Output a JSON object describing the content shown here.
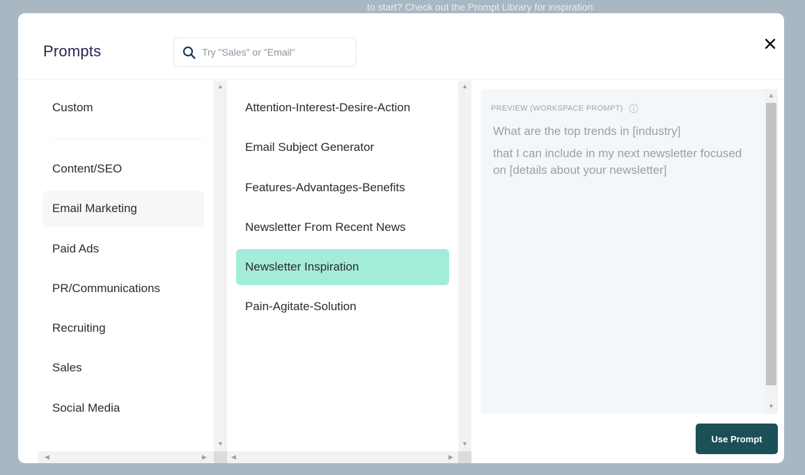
{
  "backdrop": {
    "text": "to start? Check out the Prompt Library for inspiration."
  },
  "header": {
    "title": "Prompts",
    "search_placeholder": "Try \"Sales\" or \"Email\"",
    "search_value": ""
  },
  "categories": [
    "Custom",
    "Content/SEO",
    "Email Marketing",
    "Paid Ads",
    "PR/Communications",
    "Recruiting",
    "Sales",
    "Social Media"
  ],
  "active_category": "Email Marketing",
  "prompts": [
    "Attention-Interest-Desire-Action",
    "Email Subject Generator",
    "Features-Advantages-Benefits",
    "Newsletter From Recent News",
    "Newsletter Inspiration",
    "Pain-Agitate-Solution"
  ],
  "active_prompt": "Newsletter Inspiration",
  "preview": {
    "label": "PREVIEW (WORKSPACE PROMPT)",
    "line1": "What are the top trends in [industry]",
    "line2": "that I can include in my next newsletter focused on [details about your newsletter]"
  },
  "actions": {
    "use_prompt": "Use Prompt"
  },
  "colors": {
    "accent": "#a3ecd9",
    "primary_button": "#1b5058",
    "title": "#2a2350"
  },
  "icons": {
    "search": "search-icon",
    "close": "close-icon",
    "info": "info-icon"
  }
}
